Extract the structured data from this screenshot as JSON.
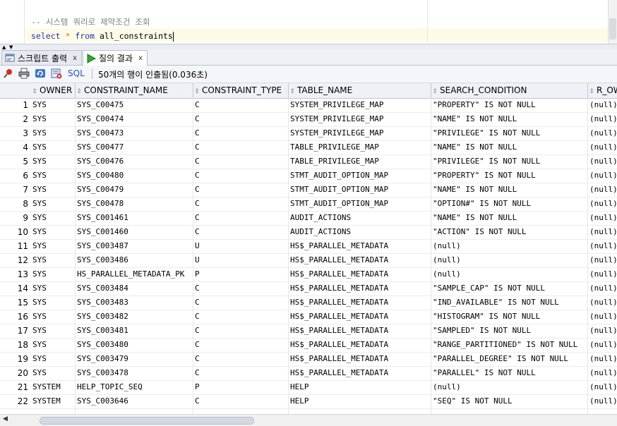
{
  "editor": {
    "line1": "-- 시스템 쿼리로 제약조건 조회",
    "kw_select": "select",
    "star": "*",
    "kw_from": "from",
    "table": "all_constraints"
  },
  "tabs": [
    {
      "label": "스크립트 출력",
      "close": "x"
    },
    {
      "label": "질의 결과",
      "close": "x"
    }
  ],
  "toolbar": {
    "sql_label": "SQL",
    "status": "50개의 행이 인출됨(0.036초)"
  },
  "columns": [
    "OWNER",
    "CONSTRAINT_NAME",
    "CONSTRAINT_TYPE",
    "TABLE_NAME",
    "SEARCH_CONDITION",
    "R_OWNER"
  ],
  "rows": [
    {
      "n": "1",
      "owner": "SYS",
      "name": "SYS_C00475",
      "type": "C",
      "table": "SYSTEM_PRIVILEGE_MAP",
      "cond": "\"PROPERTY\" IS NOT NULL",
      "r": "(null)"
    },
    {
      "n": "2",
      "owner": "SYS",
      "name": "SYS_C00474",
      "type": "C",
      "table": "SYSTEM_PRIVILEGE_MAP",
      "cond": "\"NAME\" IS NOT NULL",
      "r": "(null)"
    },
    {
      "n": "3",
      "owner": "SYS",
      "name": "SYS_C00473",
      "type": "C",
      "table": "SYSTEM_PRIVILEGE_MAP",
      "cond": "\"PRIVILEGE\" IS NOT NULL",
      "r": "(null)"
    },
    {
      "n": "4",
      "owner": "SYS",
      "name": "SYS_C00477",
      "type": "C",
      "table": "TABLE_PRIVILEGE_MAP",
      "cond": "\"NAME\" IS NOT NULL",
      "r": "(null)"
    },
    {
      "n": "5",
      "owner": "SYS",
      "name": "SYS_C00476",
      "type": "C",
      "table": "TABLE_PRIVILEGE_MAP",
      "cond": "\"PRIVILEGE\" IS NOT NULL",
      "r": "(null)"
    },
    {
      "n": "6",
      "owner": "SYS",
      "name": "SYS_C00480",
      "type": "C",
      "table": "STMT_AUDIT_OPTION_MAP",
      "cond": "\"PROPERTY\" IS NOT NULL",
      "r": "(null)"
    },
    {
      "n": "7",
      "owner": "SYS",
      "name": "SYS_C00479",
      "type": "C",
      "table": "STMT_AUDIT_OPTION_MAP",
      "cond": "\"NAME\" IS NOT NULL",
      "r": "(null)"
    },
    {
      "n": "8",
      "owner": "SYS",
      "name": "SYS_C00478",
      "type": "C",
      "table": "STMT_AUDIT_OPTION_MAP",
      "cond": "\"OPTION#\" IS NOT NULL",
      "r": "(null)"
    },
    {
      "n": "9",
      "owner": "SYS",
      "name": "SYS_C001461",
      "type": "C",
      "table": "AUDIT_ACTIONS",
      "cond": "\"NAME\" IS NOT NULL",
      "r": "(null)"
    },
    {
      "n": "10",
      "owner": "SYS",
      "name": "SYS_C001460",
      "type": "C",
      "table": "AUDIT_ACTIONS",
      "cond": "\"ACTION\" IS NOT NULL",
      "r": "(null)"
    },
    {
      "n": "11",
      "owner": "SYS",
      "name": "SYS_C003487",
      "type": "U",
      "table": "HS$_PARALLEL_METADATA",
      "cond": "(null)",
      "r": "(null)"
    },
    {
      "n": "12",
      "owner": "SYS",
      "name": "SYS_C003486",
      "type": "U",
      "table": "HS$_PARALLEL_METADATA",
      "cond": "(null)",
      "r": "(null)"
    },
    {
      "n": "13",
      "owner": "SYS",
      "name": "HS_PARALLEL_METADATA_PK",
      "type": "P",
      "table": "HS$_PARALLEL_METADATA",
      "cond": "(null)",
      "r": "(null)"
    },
    {
      "n": "14",
      "owner": "SYS",
      "name": "SYS_C003484",
      "type": "C",
      "table": "HS$_PARALLEL_METADATA",
      "cond": "\"SAMPLE_CAP\" IS NOT NULL",
      "r": "(null)"
    },
    {
      "n": "15",
      "owner": "SYS",
      "name": "SYS_C003483",
      "type": "C",
      "table": "HS$_PARALLEL_METADATA",
      "cond": "\"IND_AVAILABLE\" IS NOT NULL",
      "r": "(null)"
    },
    {
      "n": "16",
      "owner": "SYS",
      "name": "SYS_C003482",
      "type": "C",
      "table": "HS$_PARALLEL_METADATA",
      "cond": "\"HISTOGRAM\" IS NOT NULL",
      "r": "(null)"
    },
    {
      "n": "17",
      "owner": "SYS",
      "name": "SYS_C003481",
      "type": "C",
      "table": "HS$_PARALLEL_METADATA",
      "cond": "\"SAMPLED\" IS NOT NULL",
      "r": "(null)"
    },
    {
      "n": "18",
      "owner": "SYS",
      "name": "SYS_C003480",
      "type": "C",
      "table": "HS$_PARALLEL_METADATA",
      "cond": "\"RANGE_PARTITIONED\" IS NOT NULL",
      "r": "(null)"
    },
    {
      "n": "19",
      "owner": "SYS",
      "name": "SYS_C003479",
      "type": "C",
      "table": "HS$_PARALLEL_METADATA",
      "cond": "\"PARALLEL_DEGREE\" IS NOT NULL",
      "r": "(null)"
    },
    {
      "n": "20",
      "owner": "SYS",
      "name": "SYS_C003478",
      "type": "C",
      "table": "HS$_PARALLEL_METADATA",
      "cond": "\"PARALLEL\" IS NOT NULL",
      "r": "(null)"
    },
    {
      "n": "21",
      "owner": "SYSTEM",
      "name": "HELP_TOPIC_SEQ",
      "type": "P",
      "table": "HELP",
      "cond": "(null)",
      "r": "(null)"
    },
    {
      "n": "22",
      "owner": "SYSTEM",
      "name": "SYS_C003646",
      "type": "C",
      "table": "HELP",
      "cond": "\"SEQ\" IS NOT NULL",
      "r": "(null)"
    }
  ]
}
